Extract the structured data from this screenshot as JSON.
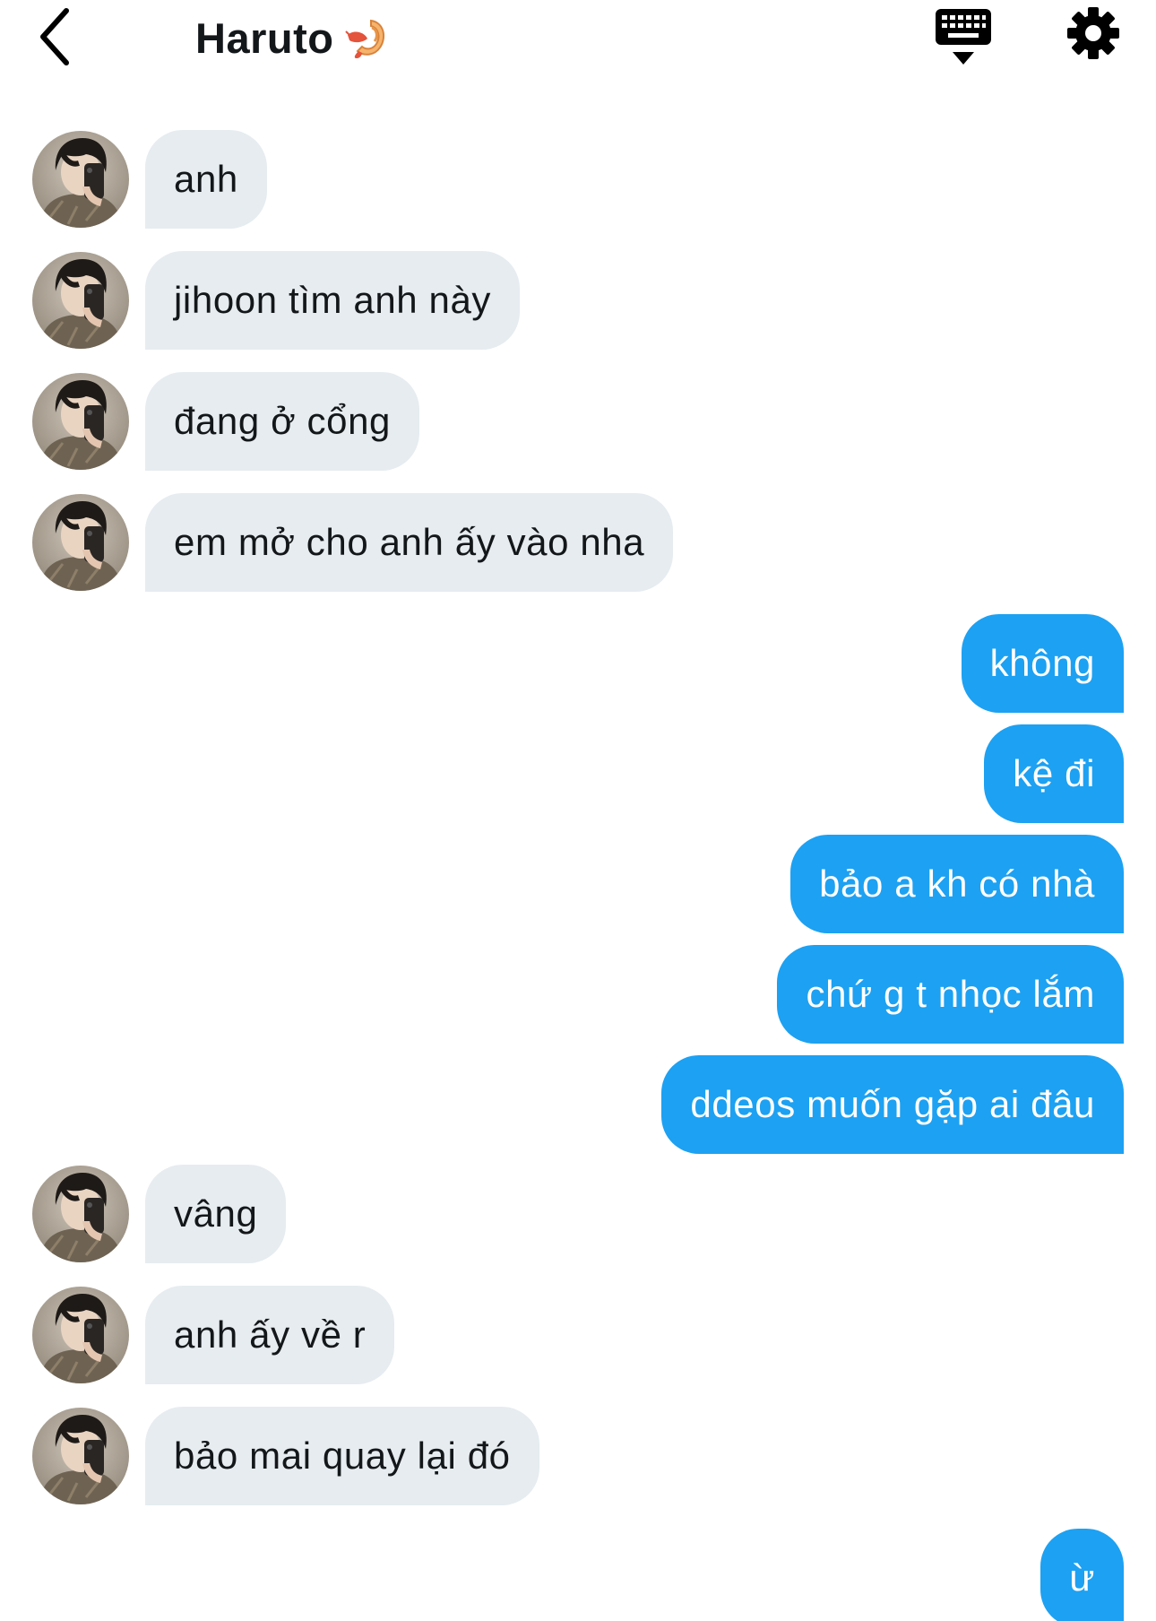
{
  "header": {
    "title": "Haruto",
    "title_emoji": "shrimp-emoji",
    "back_icon": "chevron-left-icon",
    "keyboard_icon": "keyboard-hide-icon",
    "settings_icon": "gear-icon"
  },
  "colors": {
    "incoming_bubble": "#e6ecf0",
    "outgoing_bubble": "#1da1f2",
    "outgoing_text": "#ffffff",
    "incoming_text": "#14171a"
  },
  "messages": [
    {
      "direction": "incoming",
      "text": "anh"
    },
    {
      "direction": "incoming",
      "text": "jihoon tìm anh này"
    },
    {
      "direction": "incoming",
      "text": "đang ở cổng"
    },
    {
      "direction": "incoming",
      "text": "em mở cho anh ấy vào nha"
    },
    {
      "direction": "outgoing",
      "text": "không"
    },
    {
      "direction": "outgoing",
      "text": "kệ đi"
    },
    {
      "direction": "outgoing",
      "text": "bảo a kh có nhà"
    },
    {
      "direction": "outgoing",
      "text": "chứ g t nhọc lắm"
    },
    {
      "direction": "outgoing",
      "text": "ddeos muốn gặp ai đâu"
    },
    {
      "direction": "incoming",
      "text": "vâng"
    },
    {
      "direction": "incoming",
      "text": "anh ấy về r"
    },
    {
      "direction": "incoming",
      "text": "bảo mai quay lại đó"
    },
    {
      "direction": "outgoing",
      "text": "ừ"
    }
  ]
}
